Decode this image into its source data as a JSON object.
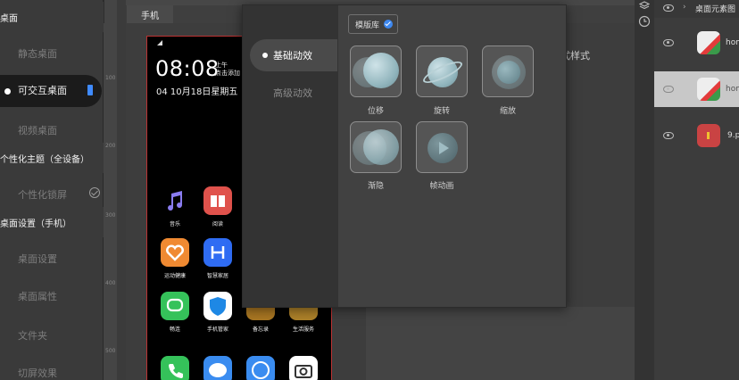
{
  "sidebar": {
    "head_desktop": "桌面",
    "static_desktop": "静态桌面",
    "interactive_desktop": "可交互桌面",
    "video_desktop": "视频桌面",
    "personal_theme_head": "个性化主题（全设备）",
    "personal_lock": "个性化锁屏",
    "desktop_settings_head": "桌面设置（手机）",
    "desktop_settings": "桌面设置",
    "desktop_props": "桌面属性",
    "folder": "文件夹",
    "switch_effect": "切屏效果"
  },
  "canvas": {
    "tab_phone": "手机",
    "ruler_marks": [
      "100",
      "200",
      "300",
      "400",
      "500"
    ],
    "style_text": "式样式"
  },
  "phone": {
    "time": "08:08",
    "am": "上午",
    "tap_add": "点击添加",
    "date": "04 10月18日星期五",
    "apps": [
      {
        "label": "音乐",
        "color": "#1b1b2e"
      },
      {
        "label": "阅读",
        "color": "#e0524c"
      },
      {
        "label": "运动健康",
        "color": "#f08a32"
      },
      {
        "label": "智慧家居",
        "color": "#2f6cf3"
      },
      {
        "label": "畅连",
        "color": "#35c25a"
      },
      {
        "label": "手机管家",
        "color": "#ffffff"
      },
      {
        "label": "备忘录",
        "color": "#f0a830"
      },
      {
        "label": "生活服务",
        "color": "#f5b63a"
      }
    ]
  },
  "popup": {
    "tab_basic": "基础动效",
    "tab_advanced": "高级动效",
    "template_lib": "模版库",
    "anims": [
      {
        "label": "位移"
      },
      {
        "label": "旋转"
      },
      {
        "label": "缩放"
      },
      {
        "label": "渐隐"
      },
      {
        "label": "帧动画"
      }
    ]
  },
  "layers": {
    "group_name": "桌面元素图",
    "rows": [
      {
        "name": "hom"
      },
      {
        "name": "hom"
      },
      {
        "name": "9.p"
      }
    ]
  },
  "colors": {
    "accent_blue": "#3f8bff",
    "phone_border": "#bb3333"
  }
}
